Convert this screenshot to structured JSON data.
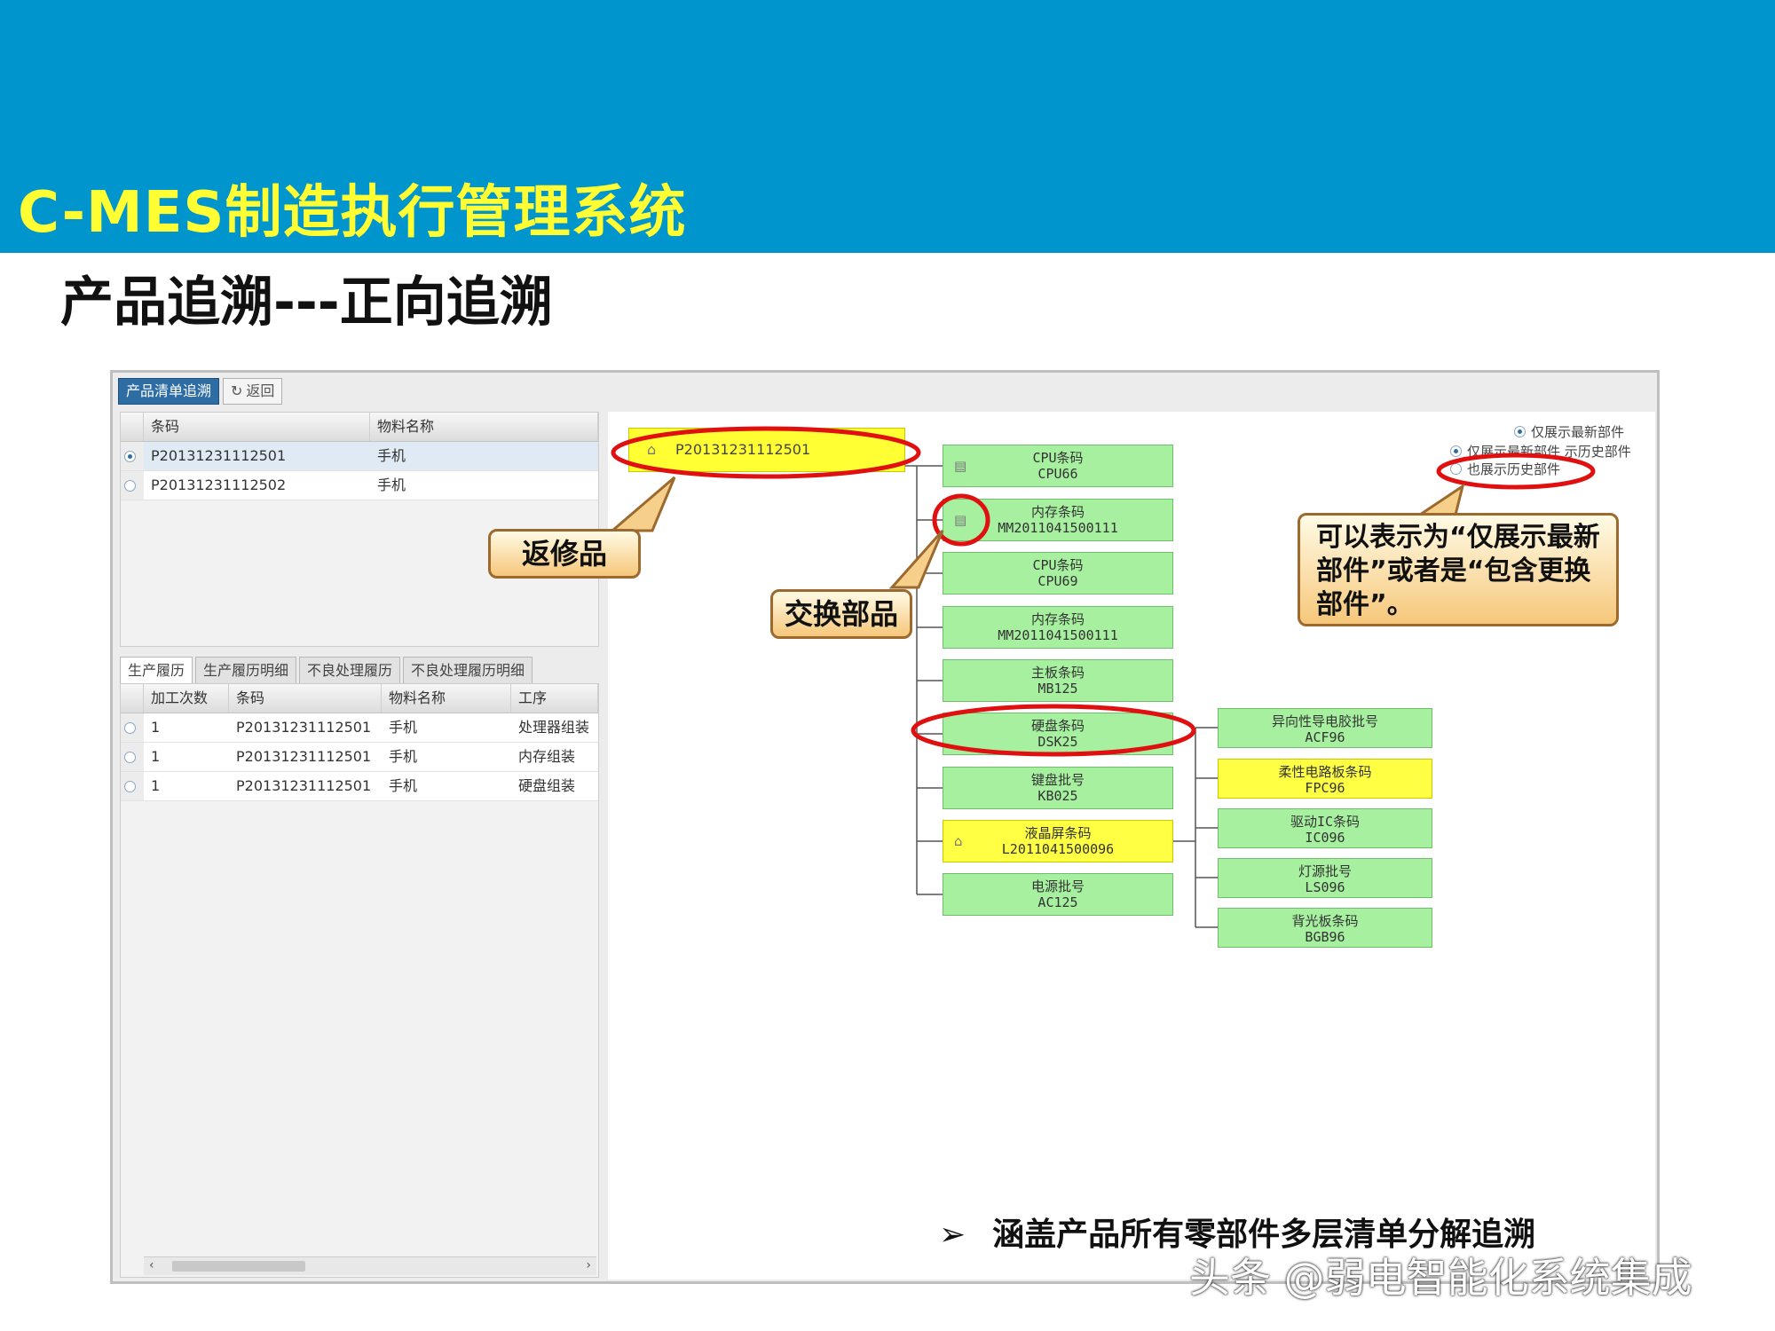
{
  "header": {
    "title": "C-MES制造执行管理系统"
  },
  "subtitle": "产品追溯---正向追溯",
  "toolbar": {
    "tab_label": "产品清单追溯",
    "back_label": "返回"
  },
  "top_grid": {
    "columns": [
      "条码",
      "物料名称"
    ],
    "rows": [
      {
        "barcode": "P20131231112501",
        "name": "手机",
        "selected": true
      },
      {
        "barcode": "P20131231112502",
        "name": "手机",
        "selected": false
      }
    ]
  },
  "bottom_tabs": [
    "生产履历",
    "生产履历明细",
    "不良处理履历",
    "不良处理履历明细"
  ],
  "bottom_grid": {
    "columns": [
      "加工次数",
      "条码",
      "物料名称",
      "工序"
    ],
    "rows": [
      {
        "count": "1",
        "barcode": "P20131231112501",
        "name": "手机",
        "process": "处理器组装"
      },
      {
        "count": "1",
        "barcode": "P20131231112501",
        "name": "手机",
        "process": "内存组装"
      },
      {
        "count": "1",
        "barcode": "P20131231112501",
        "name": "手机",
        "process": "硬盘组装"
      }
    ]
  },
  "tree": {
    "root": {
      "code": "P20131231112501",
      "icon": "home-icon"
    },
    "level1": [
      {
        "label": "CPU条码",
        "value": "CPU66",
        "icon": "document-icon"
      },
      {
        "label": "内存条码",
        "value": "MM2011041500111",
        "icon": "document-icon"
      },
      {
        "label": "CPU条码",
        "value": "CPU69"
      },
      {
        "label": "内存条码",
        "value": "MM2011041500111"
      },
      {
        "label": "主板条码",
        "value": "MB125"
      },
      {
        "label": "硬盘条码",
        "value": "DSK25"
      },
      {
        "label": "键盘批号",
        "value": "KB025"
      },
      {
        "label": "液晶屏条码",
        "value": "L2011041500096",
        "icon": "home-icon",
        "highlight": true
      },
      {
        "label": "电源批号",
        "value": "AC125"
      }
    ],
    "level2": [
      {
        "label": "异向性导电胶批号",
        "value": "ACF96"
      },
      {
        "label": "柔性电路板条码",
        "value": "FPC96",
        "highlight": true
      },
      {
        "label": "驱动IC条码",
        "value": "IC096"
      },
      {
        "label": "灯源批号",
        "value": "LS096"
      },
      {
        "label": "背光板条码",
        "value": "BGB96"
      }
    ]
  },
  "display_options": {
    "latest_only": "仅展示最新部件",
    "include_history": "也展示历史部件",
    "overlap_text": "仅展示最新部件 示历史部件"
  },
  "callouts": {
    "repair": "返修品",
    "swap": "交换部品",
    "display": "可以表示为“仅展示最新部件”或者是“包含更换部件”。"
  },
  "footer_note": "涵盖产品所有零部件多层清单分解追溯",
  "watermark": "头条 @弱电智能化系统集成",
  "colors": {
    "header": "#0095cc",
    "title": "#ffff33",
    "node_green": "#a6f0a0",
    "node_yellow": "#ffff44",
    "annotation_red": "#e01010"
  }
}
